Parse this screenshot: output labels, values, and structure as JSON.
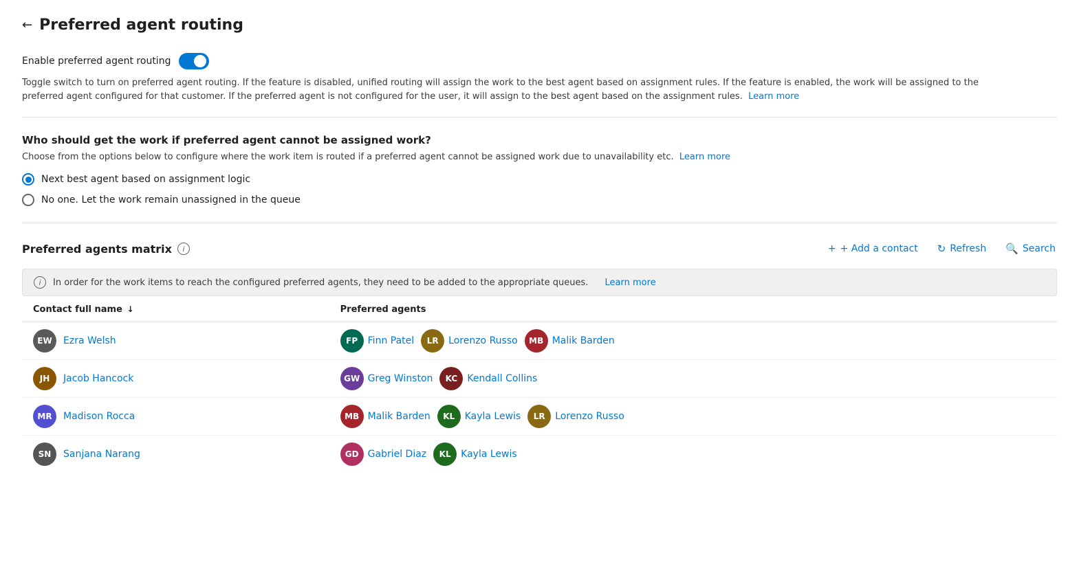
{
  "page": {
    "back_label": "←",
    "title": "Preferred agent routing"
  },
  "enable_section": {
    "label": "Enable preferred agent routing",
    "toggle_on": true,
    "description": "Toggle switch to turn on preferred agent routing. If the feature is disabled, unified routing will assign the work to the best agent based on assignment rules. If the feature is enabled, the work will be assigned to the preferred agent configured for that customer. If the preferred agent is not configured for the user, it will assign to the best agent based on the assignment rules.",
    "learn_more_label": "Learn more"
  },
  "routing_section": {
    "title": "Who should get the work if preferred agent cannot be assigned work?",
    "description": "Choose from the options below to configure where the work item is routed if a preferred agent cannot be assigned work due to unavailability etc.",
    "learn_more_label": "Learn more",
    "options": [
      {
        "id": "next_best",
        "label": "Next best agent based on assignment logic",
        "selected": true
      },
      {
        "id": "no_one",
        "label": "No one. Let the work remain unassigned in the queue",
        "selected": false
      }
    ]
  },
  "matrix_section": {
    "title": "Preferred agents matrix",
    "info_icon": "i",
    "add_contact_label": "+ Add a contact",
    "refresh_label": "Refresh",
    "search_label": "Search",
    "notice": "In order for the work items to reach the configured preferred agents, they need to be added to the appropriate queues.",
    "notice_learn_more": "Learn more",
    "table": {
      "col_contact": "Contact full name",
      "col_agents": "Preferred agents",
      "rows": [
        {
          "contact": {
            "initials": "EW",
            "color": "#5a5a5a",
            "name": "Ezra Welsh"
          },
          "agents": [
            {
              "initials": "FP",
              "color": "#006b52",
              "name": "Finn Patel"
            },
            {
              "initials": "LR",
              "color": "#8a6914",
              "name": "Lorenzo Russo"
            },
            {
              "initials": "MB",
              "color": "#a4262c",
              "name": "Malik Barden"
            }
          ]
        },
        {
          "contact": {
            "initials": "JH",
            "color": "#8a5700",
            "name": "Jacob Hancock"
          },
          "agents": [
            {
              "initials": "GW",
              "color": "#6b3d9a",
              "name": "Greg Winston"
            },
            {
              "initials": "KC",
              "color": "#7a1f1f",
              "name": "Kendall Collins"
            }
          ]
        },
        {
          "contact": {
            "initials": "MR",
            "color": "#5050d0",
            "name": "Madison Rocca"
          },
          "agents": [
            {
              "initials": "MB",
              "color": "#a4262c",
              "name": "Malik Barden"
            },
            {
              "initials": "KL",
              "color": "#1e6b1e",
              "name": "Kayla Lewis"
            },
            {
              "initials": "LR",
              "color": "#8a6914",
              "name": "Lorenzo Russo"
            }
          ]
        },
        {
          "contact": {
            "initials": "SN",
            "color": "#555555",
            "name": "Sanjana Narang"
          },
          "agents": [
            {
              "initials": "GD",
              "color": "#b03060",
              "name": "Gabriel Diaz"
            },
            {
              "initials": "KL",
              "color": "#1e6b1e",
              "name": "Kayla Lewis"
            }
          ]
        }
      ]
    }
  }
}
